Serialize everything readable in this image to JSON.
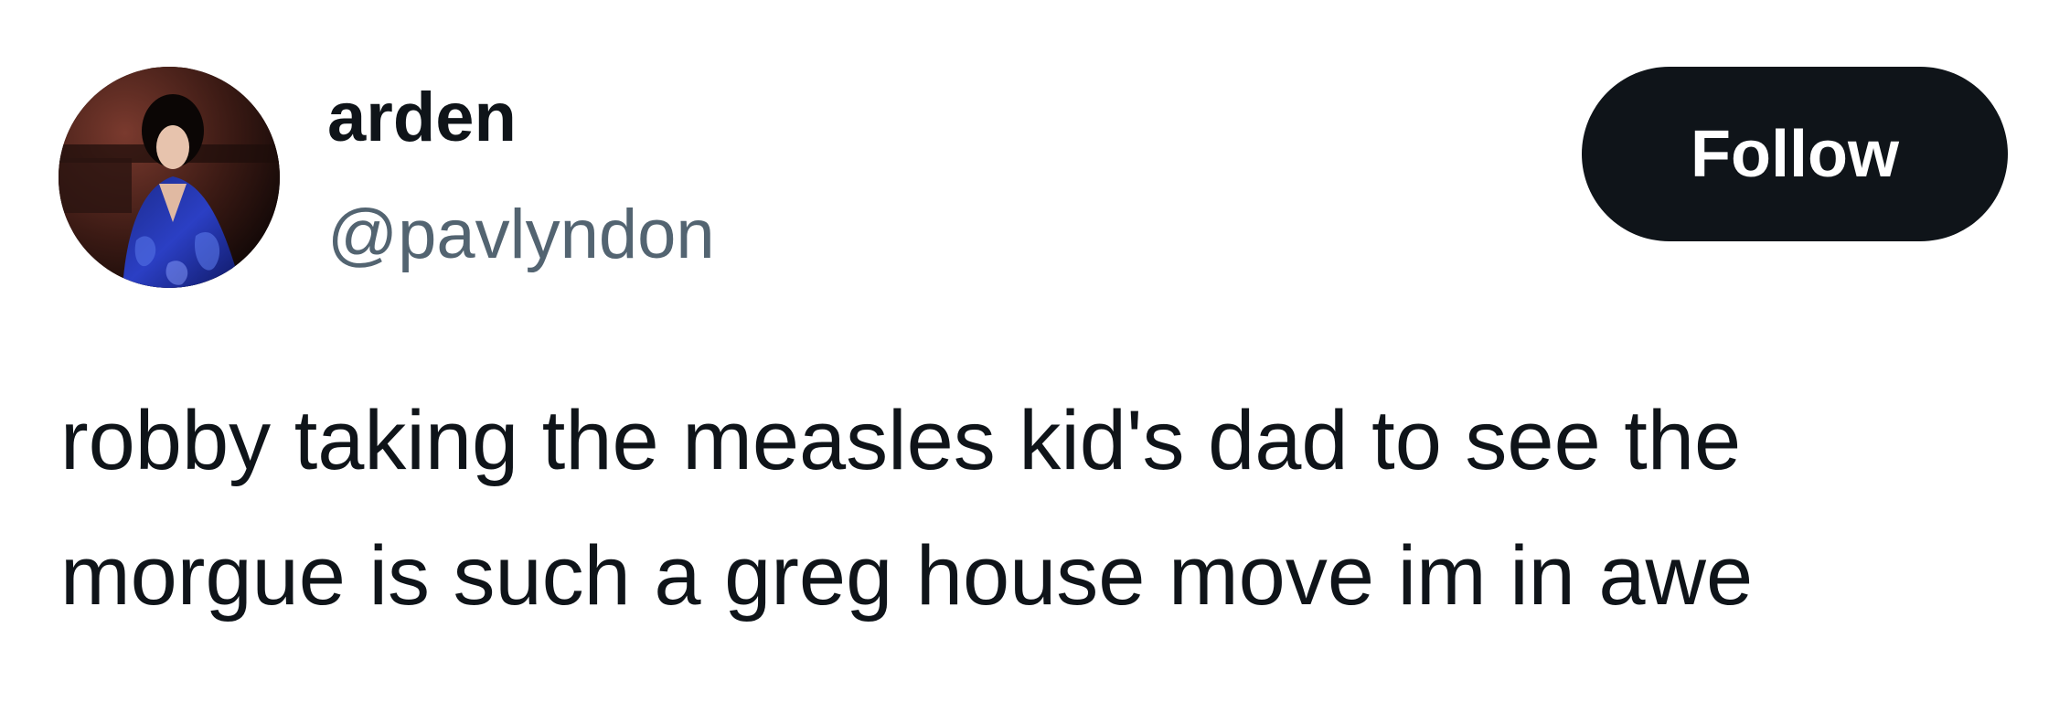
{
  "author": {
    "display_name": "arden",
    "handle": "@pavlyndon",
    "avatar_icon": "profile-photo-icon"
  },
  "actions": {
    "follow_label": "Follow",
    "follow_bg": "#0f1419",
    "follow_fg": "#ffffff"
  },
  "tweet": {
    "lines": [
      "robby taking the measles kid's dad to see the",
      "morgue is such a greg house move im in awe"
    ]
  },
  "colors": {
    "text_primary": "#0f1419",
    "text_secondary": "#536471",
    "background": "#ffffff"
  }
}
